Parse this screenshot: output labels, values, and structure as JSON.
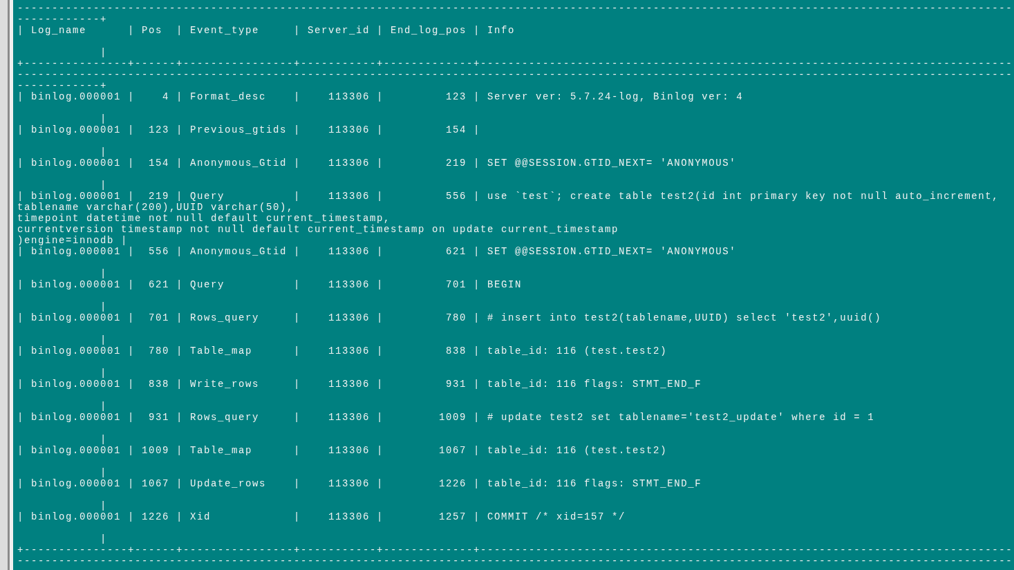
{
  "terminal": {
    "lines": [
      {
        "kind": "text",
        "text": "------------------------------------------------------------------------------------------------------------------------------------------------"
      },
      {
        "kind": "text",
        "text": "------------+"
      },
      {
        "kind": "text",
        "text": "| Log_name      | Pos  | Event_type     | Server_id | End_log_pos | Info"
      },
      {
        "kind": "blank"
      },
      {
        "kind": "text",
        "text": "            |"
      },
      {
        "kind": "text",
        "text": "+---------------+------+----------------+-----------+-------------+-----------------------------------------------------------------------------"
      },
      {
        "kind": "text",
        "text": "------------------------------------------------------------------------------------------------------------------------------------------------"
      },
      {
        "kind": "text",
        "text": "------------+"
      },
      {
        "kind": "text",
        "text": "| binlog.000001 |    4 | Format_desc    |    113306 |         123 | Server ver: 5.7.24-log, Binlog ver: 4"
      },
      {
        "kind": "blank"
      },
      {
        "kind": "text",
        "text": "            |"
      },
      {
        "kind": "text",
        "text": "| binlog.000001 |  123 | Previous_gtids |    113306 |         154 |"
      },
      {
        "kind": "blank"
      },
      {
        "kind": "text",
        "text": "            |"
      },
      {
        "kind": "text",
        "text": "| binlog.000001 |  154 | Anonymous_Gtid |    113306 |         219 | SET @@SESSION.GTID_NEXT= 'ANONYMOUS'"
      },
      {
        "kind": "blank"
      },
      {
        "kind": "text",
        "text": "            |"
      },
      {
        "kind": "text",
        "text": "| binlog.000001 |  219 | Query          |    113306 |         556 | use `test`; create table test2(id int primary key not null auto_increment,"
      },
      {
        "kind": "text",
        "text": "tablename varchar(200),UUID varchar(50),"
      },
      {
        "kind": "text",
        "text": "timepoint datetime not null default current_timestamp,"
      },
      {
        "kind": "text",
        "text": "currentversion timestamp not null default current_timestamp on update current_timestamp"
      },
      {
        "kind": "text",
        "text": ")engine=innodb |"
      },
      {
        "kind": "text",
        "text": "| binlog.000001 |  556 | Anonymous_Gtid |    113306 |         621 | SET @@SESSION.GTID_NEXT= 'ANONYMOUS'"
      },
      {
        "kind": "blank"
      },
      {
        "kind": "text",
        "text": "            |"
      },
      {
        "kind": "text",
        "text": "| binlog.000001 |  621 | Query          |    113306 |         701 | BEGIN"
      },
      {
        "kind": "blank"
      },
      {
        "kind": "text",
        "text": "            |"
      },
      {
        "kind": "text",
        "text": "| binlog.000001 |  701 | Rows_query     |    113306 |         780 | # insert into test2(tablename,UUID) select 'test2',uuid()"
      },
      {
        "kind": "blank"
      },
      {
        "kind": "text",
        "text": "            |"
      },
      {
        "kind": "text",
        "text": "| binlog.000001 |  780 | Table_map      |    113306 |         838 | table_id: 116 (test.test2)"
      },
      {
        "kind": "blank"
      },
      {
        "kind": "text",
        "text": "            |"
      },
      {
        "kind": "text",
        "text": "| binlog.000001 |  838 | Write_rows     |    113306 |         931 | table_id: 116 flags: STMT_END_F"
      },
      {
        "kind": "blank"
      },
      {
        "kind": "text",
        "text": "            |"
      },
      {
        "kind": "text",
        "text": "| binlog.000001 |  931 | Rows_query     |    113306 |        1009 | # update test2 set tablename='test2_update' where id = 1"
      },
      {
        "kind": "blank"
      },
      {
        "kind": "text",
        "text": "            |"
      },
      {
        "kind": "text",
        "text": "| binlog.000001 | 1009 | Table_map      |    113306 |        1067 | table_id: 116 (test.test2)"
      },
      {
        "kind": "blank"
      },
      {
        "kind": "text",
        "text": "            |"
      },
      {
        "kind": "text",
        "text": "| binlog.000001 | 1067 | Update_rows    |    113306 |        1226 | table_id: 116 flags: STMT_END_F"
      },
      {
        "kind": "blank"
      },
      {
        "kind": "text",
        "text": "            |"
      },
      {
        "kind": "text",
        "text": "| binlog.000001 | 1226 | Xid            |    113306 |        1257 | COMMIT /* xid=157 */"
      },
      {
        "kind": "blank"
      },
      {
        "kind": "text",
        "text": "            |"
      },
      {
        "kind": "text",
        "text": "+---------------+------+----------------+-----------+-------------+-----------------------------------------------------------------------------"
      },
      {
        "kind": "text",
        "text": "------------------------------------------------------------------------------------------------------------------------------------------------"
      }
    ]
  }
}
